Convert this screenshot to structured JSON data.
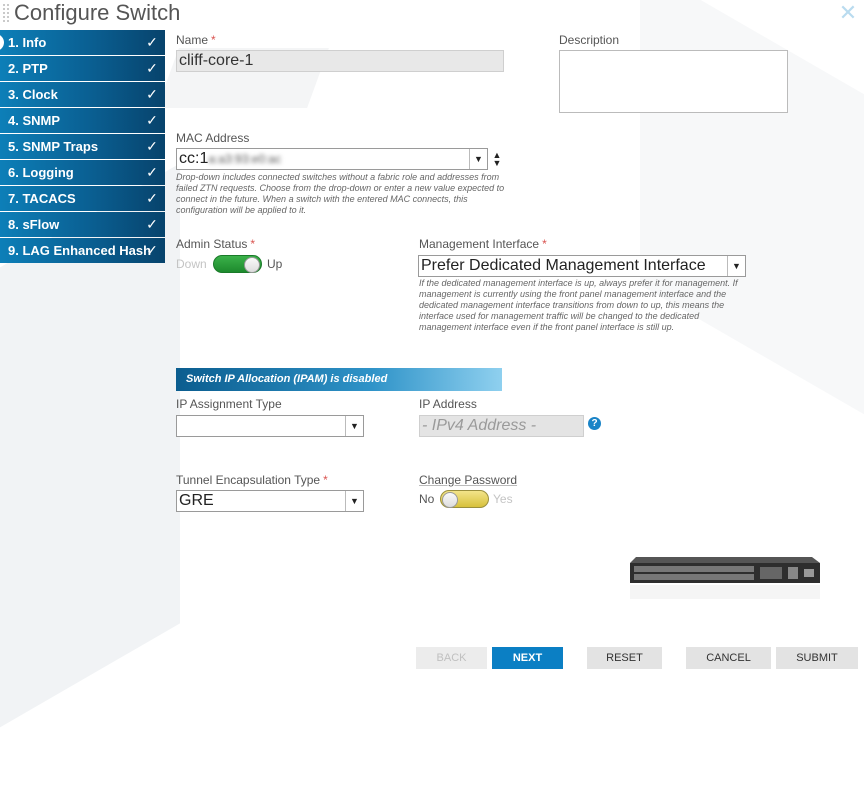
{
  "window": {
    "title": "Configure Switch",
    "close_icon": "close-icon"
  },
  "sidebar": {
    "items": [
      {
        "label": "1. Info",
        "complete": true,
        "active": true
      },
      {
        "label": "2. PTP",
        "complete": true
      },
      {
        "label": "3. Clock",
        "complete": true
      },
      {
        "label": "4. SNMP",
        "complete": true
      },
      {
        "label": "5. SNMP Traps",
        "complete": true
      },
      {
        "label": "6. Logging",
        "complete": true
      },
      {
        "label": "7. TACACS",
        "complete": true
      },
      {
        "label": "8. sFlow",
        "complete": true
      },
      {
        "label": "9. LAG Enhanced Hash",
        "complete": true
      }
    ],
    "check_glyph": "✓"
  },
  "form": {
    "name": {
      "label": "Name",
      "required_mark": "*",
      "value": "cliff-core-1"
    },
    "description": {
      "label": "Description",
      "value": ""
    },
    "mac_address": {
      "label": "MAC Address",
      "value_prefix": "cc:1",
      "value_blurred": "a:a3:93:e0:ac",
      "help": "Drop-down includes connected switches without a fabric role and addresses from failed ZTN requests. Choose from the drop-down or enter a new value expected to connect in the future. When a switch with the entered MAC connects, this configuration will be applied to it."
    },
    "admin_status": {
      "label": "Admin Status",
      "required_mark": "*",
      "off_label": "Down",
      "on_label": "Up",
      "state": "Up"
    },
    "management_interface": {
      "label": "Management Interface",
      "required_mark": "*",
      "value": "Prefer Dedicated Management Interface",
      "help": "If the dedicated management interface is up, always prefer it for management. If management is currently using the front panel management interface and the dedicated management interface transitions from down to up, this means the interface used for management traffic will be changed to the dedicated management interface even if the front panel interface is still up."
    },
    "ipam_banner": "Switch IP Allocation (IPAM) is disabled",
    "ip_assignment_type": {
      "label": "IP Assignment Type",
      "value": ""
    },
    "ip_address": {
      "label": "IP Address",
      "placeholder": "- IPv4 Address -",
      "help_icon": "?"
    },
    "tunnel_encapsulation": {
      "label": "Tunnel Encapsulation Type",
      "required_mark": "*",
      "value": "GRE"
    },
    "change_password": {
      "label": "Change Password",
      "off_label": "No",
      "on_label": "Yes",
      "state": "No"
    }
  },
  "footer": {
    "back": "BACK",
    "next": "NEXT",
    "reset": "RESET",
    "cancel": "CANCEL",
    "submit": "SUBMIT"
  },
  "colors": {
    "sidebar_accent": "#0a5f92",
    "next_button": "#0b7fc4",
    "required": "#d9534f",
    "toggle_on": "#2a9e3a",
    "toggle_off": "#e2cf55"
  }
}
